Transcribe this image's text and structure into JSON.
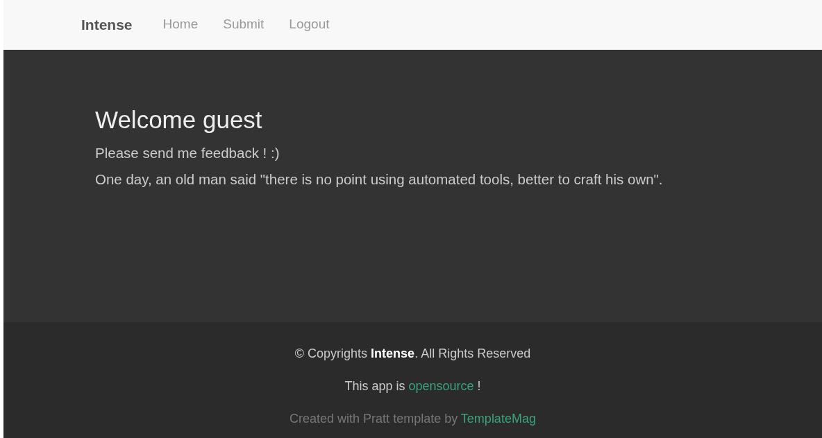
{
  "navbar": {
    "brand": "Intense",
    "links": [
      {
        "label": "Home"
      },
      {
        "label": "Submit"
      },
      {
        "label": "Logout"
      }
    ]
  },
  "hero": {
    "title": "Welcome guest",
    "lines": [
      "Please send me feedback ! :)",
      "One day, an old man said \"there is no point using automated tools, better to craft his own\"."
    ]
  },
  "footer": {
    "copyright": "© Copyrights **Intense**. All Rights Reserved",
    "app_line": {
      "before": "This app is ",
      "link": "opensource",
      "after": " !"
    },
    "credit": {
      "before": "Created with Pratt template by ",
      "link": "TemplateMag"
    }
  }
}
